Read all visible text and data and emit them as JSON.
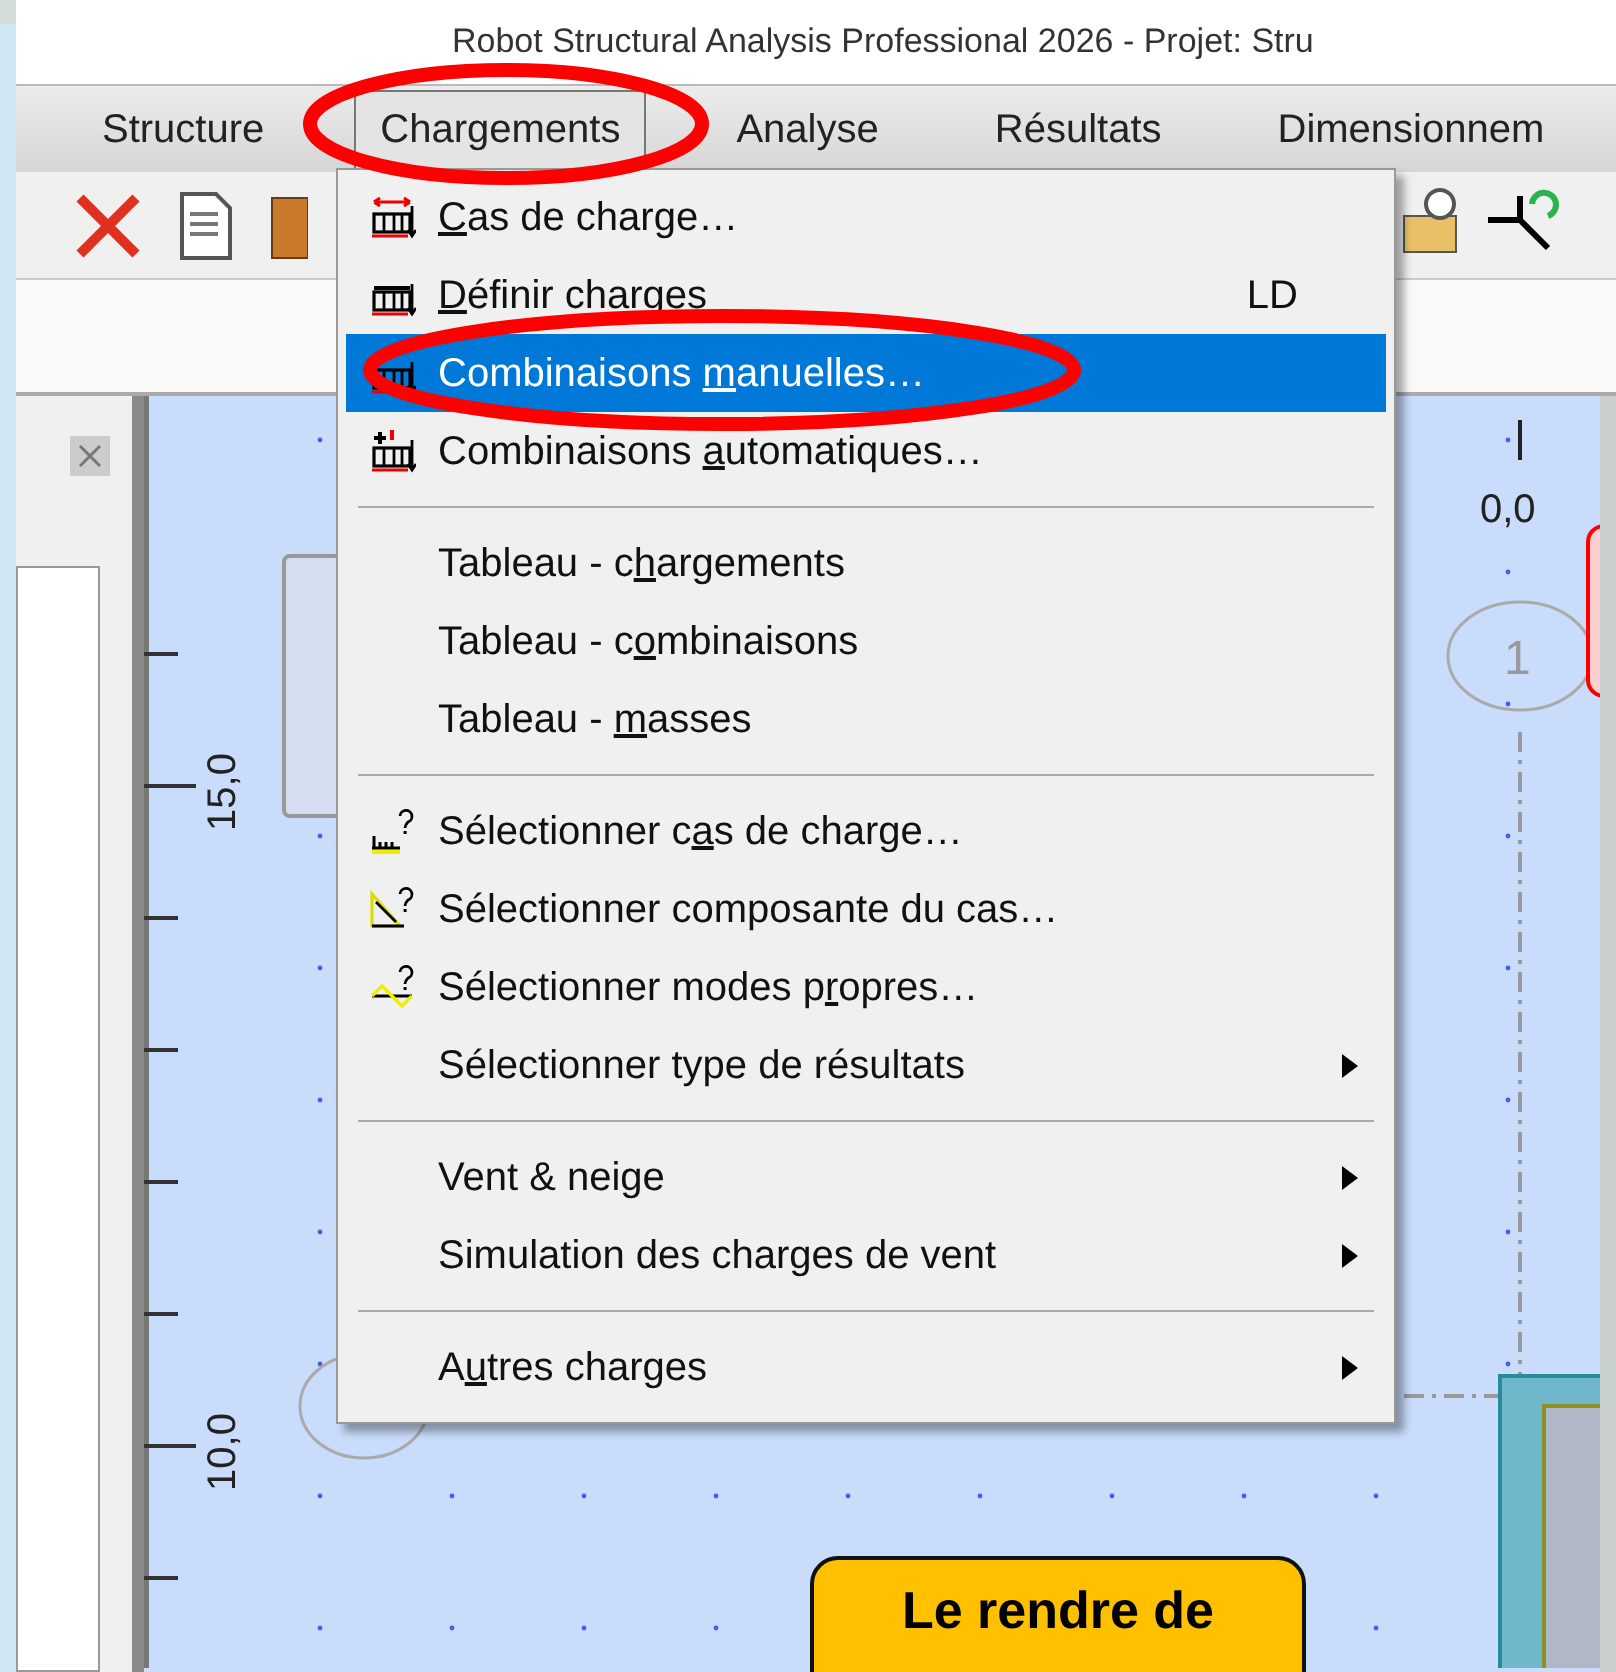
{
  "window": {
    "title": "Robot Structural Analysis Professional 2026 - Projet: Stru"
  },
  "menu_bar": [
    {
      "label": "Structure",
      "selected": false
    },
    {
      "label": "Chargements",
      "selected": true
    },
    {
      "label": "Analyse",
      "selected": false
    },
    {
      "label": "Résultats",
      "selected": false
    },
    {
      "label": "Dimensionnem",
      "selected": false
    }
  ],
  "menu": {
    "items": [
      {
        "kind": "item",
        "underlined": "C",
        "label_end": "as de charge…",
        "selected": false,
        "submenu": false
      },
      {
        "kind": "item",
        "underlined": "D",
        "label_end": "éfinir charges",
        "shortcut": "LD",
        "selected": false,
        "submenu": false
      },
      {
        "kind": "item",
        "label_start": "Combinaisons ",
        "underlined": "m",
        "label_end": "anuelles…",
        "selected": true,
        "submenu": false
      },
      {
        "kind": "item",
        "label_start": "Combinaisons ",
        "underlined": "a",
        "label_end": "utomatiques…",
        "selected": false,
        "submenu": false
      },
      {
        "kind": "separator"
      },
      {
        "kind": "item",
        "label_start": "Tableau - c",
        "underlined": "h",
        "label_end": "argements",
        "selected": false,
        "submenu": false
      },
      {
        "kind": "item",
        "label_start": "Tableau - c",
        "underlined": "o",
        "label_end": "mbinaisons",
        "selected": false,
        "submenu": false
      },
      {
        "kind": "item",
        "label_start": "Tableau - ",
        "underlined": "m",
        "label_end": "asses",
        "selected": false,
        "submenu": false
      },
      {
        "kind": "separator"
      },
      {
        "kind": "item",
        "label_start": "Sélectionner c",
        "underlined": "a",
        "label_end": "s de charge…",
        "selected": false,
        "submenu": false
      },
      {
        "kind": "item",
        "label_start": "Sélectionner composante du cas…",
        "selected": false,
        "submenu": false
      },
      {
        "kind": "item",
        "label_start": "Sélectionner modes p",
        "underlined": "r",
        "label_end": "opres…",
        "selected": false,
        "submenu": false
      },
      {
        "kind": "item",
        "label_start": "Sélectionner type de résultats",
        "selected": false,
        "submenu": true
      },
      {
        "kind": "separator"
      },
      {
        "kind": "item",
        "label_start": "Vent & neige",
        "selected": false,
        "submenu": true
      },
      {
        "kind": "item",
        "label_start": "Simulation des charges de vent",
        "selected": false,
        "submenu": true
      },
      {
        "kind": "separator"
      },
      {
        "kind": "item",
        "label_start": "A",
        "underlined": "u",
        "label_end": "tres charges",
        "selected": false,
        "submenu": true
      }
    ]
  },
  "canvas": {
    "ruler_labels": [
      "15,0",
      "10,0"
    ],
    "origin_label": "0,0",
    "axis_bubble": "1",
    "callout": "Le rendre de"
  }
}
